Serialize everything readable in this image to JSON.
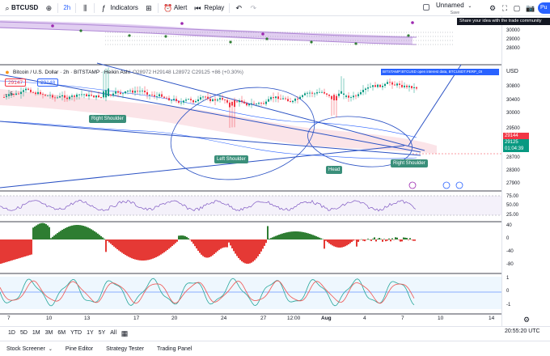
{
  "toolbar": {
    "symbol": "BTCUSD",
    "add_symbol_icon": "plus-circle-icon",
    "interval": "2h",
    "indicators_label": "Indicators",
    "alert_label": "Alert",
    "replay_label": "Replay",
    "layout_name": "Unnamed",
    "layout_status": "Save",
    "publish_label": "Pu"
  },
  "tooltip": "Share your idea with the trade community",
  "legend": {
    "title": "Bitcoin / U.S. Dollar · 2h · BITSTAMP · Heikin Ashi",
    "ohlc": "O28972 H29148 L28972 C29125 +86 (+0.30%)",
    "bid": "29147",
    "ask": "29148",
    "indicator_count": "5",
    "oi_banner": "BITSTAMP:BTCUSD open interest data, BTCUSDT.PERP_OI"
  },
  "price_scale": {
    "currency": "USD",
    "top_pane_labels": [
      "30000",
      "29000",
      "28000"
    ],
    "main_labels": [
      "30800",
      "30400",
      "30000",
      "29500",
      "28700",
      "28300",
      "27900"
    ],
    "current_price": "29144",
    "close_price": "29125",
    "countdown": "01:04:39",
    "rsi_labels": [
      "75.00",
      "50.00",
      "25.00"
    ],
    "osc1_labels": [
      "40",
      "0",
      "-40",
      "-80"
    ],
    "osc2_labels": [
      "1",
      "0",
      "-1"
    ]
  },
  "pattern_labels": {
    "right_shoulder_1": "Right Shoulder",
    "left_shoulder": "Left Shoulder",
    "head": "Head",
    "right_shoulder_2": "Right Shoulder"
  },
  "time_axis": [
    "7",
    "10",
    "13",
    "17",
    "20",
    "24",
    "27",
    "12:00",
    "Aug",
    "4",
    "7",
    "10",
    "14"
  ],
  "range_bar": [
    "1D",
    "5D",
    "1M",
    "3M",
    "6M",
    "YTD",
    "1Y",
    "5Y",
    "All"
  ],
  "clock": "20:55:20 UTC",
  "bottom_tabs": [
    "Stock Screener",
    "Pine Editor",
    "Strategy Tester",
    "Trading Panel"
  ],
  "colors": {
    "accent": "#2962ff",
    "up": "#089981",
    "down": "#f23645",
    "pattern": "#3a8f7a"
  }
}
